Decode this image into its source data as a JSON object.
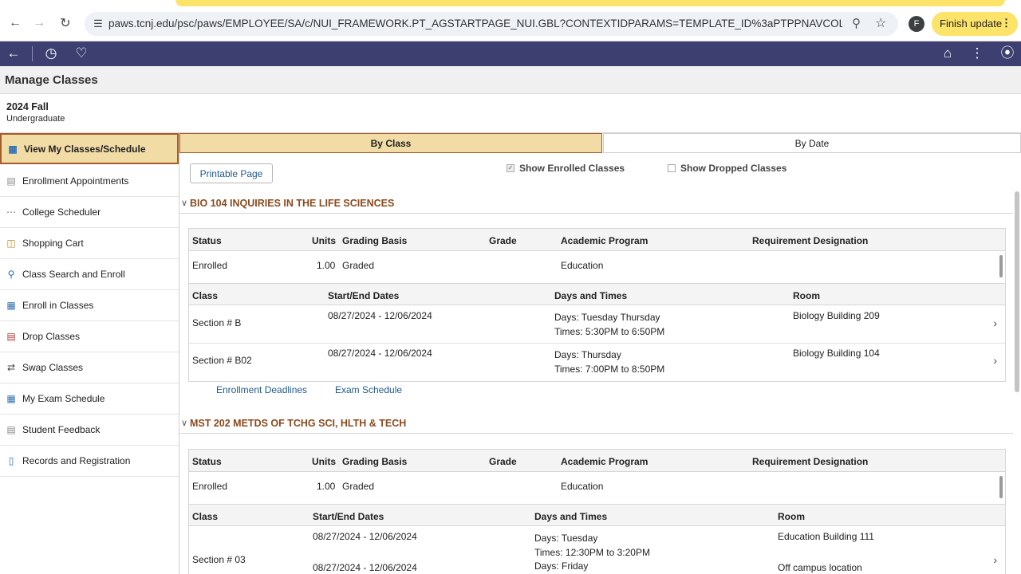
{
  "browser": {
    "url": "paws.tcnj.edu/psc/paws/EMPLOYEE/SA/c/NUI_FRAMEWORK.PT_AGSTARTPAGE_NUI.GBL?CONTEXTIDPARAMS=TEMPLATE_ID%3aPTPPNAVCOL&scname=T...",
    "profile_initial": "F",
    "finish_update_label": "Finish update"
  },
  "page": {
    "title": "Manage Classes",
    "term": "2024 Fall",
    "career": "Undergraduate"
  },
  "sidebar": {
    "items": [
      {
        "label": "View My Classes/Schedule",
        "icon": "calendar-icon"
      },
      {
        "label": "Enrollment Appointments",
        "icon": "document-icon"
      },
      {
        "label": "College Scheduler",
        "icon": "scheduler-icon"
      },
      {
        "label": "Shopping Cart",
        "icon": "cart-icon"
      },
      {
        "label": "Class Search and Enroll",
        "icon": "search-icon"
      },
      {
        "label": "Enroll in Classes",
        "icon": "table-icon"
      },
      {
        "label": "Drop Classes",
        "icon": "drop-icon"
      },
      {
        "label": "Swap Classes",
        "icon": "swap-icon"
      },
      {
        "label": "My Exam Schedule",
        "icon": "table-icon"
      },
      {
        "label": "Student Feedback",
        "icon": "clipboard-icon"
      },
      {
        "label": "Records and Registration",
        "icon": "building-icon"
      }
    ]
  },
  "tabs": {
    "by_class": "By Class",
    "by_date": "By Date"
  },
  "controls": {
    "printable_page": "Printable Page",
    "show_enrolled": "Show Enrolled Classes",
    "show_dropped": "Show Dropped Classes"
  },
  "headers": {
    "status": "Status",
    "units": "Units",
    "grading_basis": "Grading Basis",
    "grade": "Grade",
    "academic_program": "Academic Program",
    "requirement_designation": "Requirement Designation",
    "class": "Class",
    "start_end_dates": "Start/End Dates",
    "days_and_times": "Days and Times",
    "room": "Room"
  },
  "courses": [
    {
      "title": "BIO 104 INQUIRIES IN THE LIFE SCIENCES",
      "status": "Enrolled",
      "units": "1.00",
      "grading_basis": "Graded",
      "grade": "",
      "academic_program": "Education",
      "sections": [
        {
          "class": "Section # B",
          "dates": "08/27/2024 - 12/06/2024",
          "days": "Days: Tuesday Thursday",
          "times": "Times: 5:30PM to 6:50PM",
          "room": "Biology Building 209"
        },
        {
          "class": "Section # B02",
          "dates": "08/27/2024 - 12/06/2024",
          "days": "Days: Thursday",
          "times": "Times: 7:00PM to 8:50PM",
          "room": "Biology Building 104"
        }
      ],
      "links": [
        "Enrollment Deadlines",
        "Exam Schedule"
      ]
    },
    {
      "title": "MST 202 METDS OF TCHG SCI, HLTH & TECH",
      "status": "Enrolled",
      "units": "1.00",
      "grading_basis": "Graded",
      "grade": "",
      "academic_program": "Education",
      "sections": [
        {
          "class": "Section # 03",
          "dates": "08/27/2024 - 12/06/2024",
          "dates2": "08/27/2024 - 12/06/2024",
          "days": "Days: Tuesday",
          "times": "Times: 12:30PM to 3:20PM",
          "days2": "Days: Friday",
          "room": "Education Building 111",
          "room2": "Off campus location"
        }
      ]
    }
  ]
}
